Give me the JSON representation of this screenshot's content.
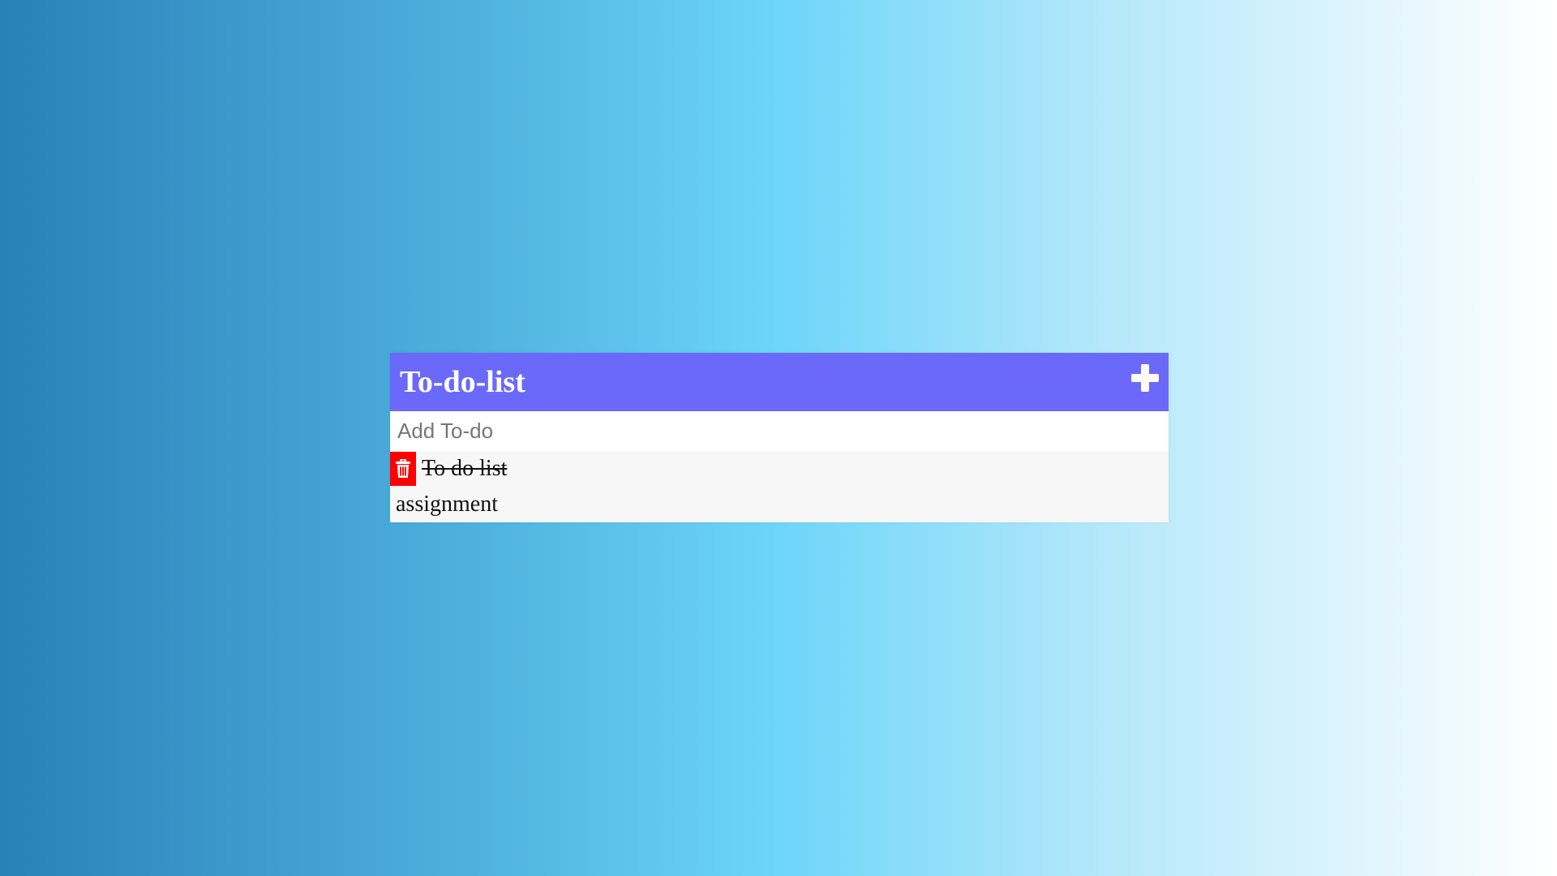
{
  "app": {
    "title": "To-do-list",
    "add_toggle_icon": "plus-icon"
  },
  "input": {
    "placeholder": "Add To-do",
    "value": ""
  },
  "todos": [
    {
      "text": "To do list",
      "completed": true,
      "delete_visible": true,
      "delete_icon": "trash-icon"
    },
    {
      "text": "assignment",
      "completed": false,
      "delete_visible": false,
      "delete_icon": "trash-icon"
    }
  ],
  "colors": {
    "header": "#6b69f9",
    "delete": "#ff0000",
    "gradient_start": "#2980b9",
    "gradient_mid": "#6dd5fa",
    "gradient_end": "#ffffff"
  }
}
